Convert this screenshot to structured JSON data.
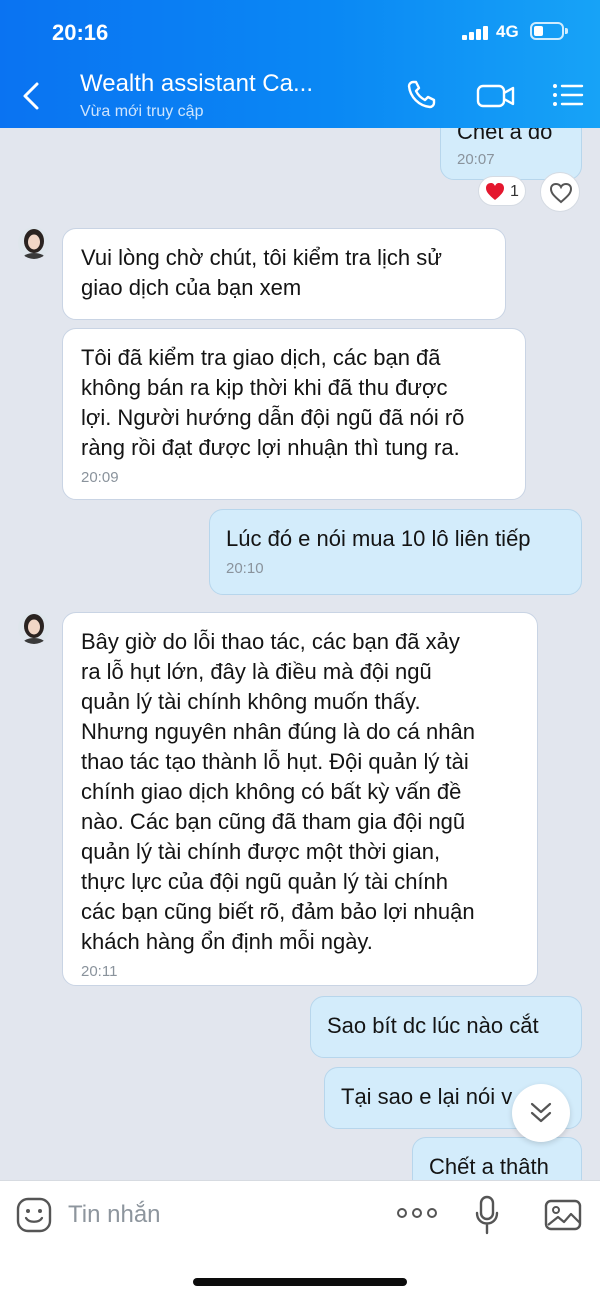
{
  "status_bar": {
    "time": "20:16",
    "network": "4G"
  },
  "header": {
    "title": "Wealth assistant Ca...",
    "subtitle": "Vừa mới truy cập"
  },
  "messages": [
    {
      "direction": "out",
      "text": "Chết a đó",
      "time": "20:07",
      "reaction": {
        "emoji": "heart",
        "count": "1"
      }
    },
    {
      "direction": "in",
      "text": "Vui lòng chờ chút, tôi kiểm tra lịch sử\ngiao dịch của bạn xem",
      "time": ""
    },
    {
      "direction": "in",
      "text": "Tôi đã kiểm tra giao dịch, các bạn đã\nkhông bán ra kịp thời khi đã thu được\nlợi.  Người hướng dẫn đội ngũ đã nói rõ\nràng rồi đạt được lợi nhuận thì tung ra.",
      "time": "20:09"
    },
    {
      "direction": "out",
      "text": "Lúc đó e nói mua 10 lô liên tiếp",
      "time": "20:10"
    },
    {
      "direction": "in",
      "text": "Bây giờ do lỗi thao tác, các bạn đã xảy\nra lỗ hụt lớn, đây là điều mà đội ngũ\nquản lý tài chính không muốn thấy.\nNhưng nguyên nhân đúng là do cá nhân\nthao tác tạo thành lỗ hụt. Đội quản lý tài\nchính giao dịch không có bất kỳ vấn đề\nnào. Các bạn cũng đã tham gia đội ngũ\nquản lý tài chính được một thời gian,\nthực lực của đội ngũ quản lý tài chính\ncác bạn cũng biết rõ, đảm bảo lợi nhuận\nkhách hàng ổn định mỗi ngày.",
      "time": "20:11"
    },
    {
      "direction": "out",
      "text": "Sao bít dc lúc nào cắt",
      "time": ""
    },
    {
      "direction": "out",
      "text": "Tại sao e lại nói v",
      "time": ""
    },
    {
      "direction": "out",
      "text": "Chết a thâth",
      "time": ""
    }
  ],
  "input": {
    "placeholder": "Tin nhắn"
  },
  "colors": {
    "header_start": "#0a73f2",
    "header_end": "#17a3f7",
    "outgoing_bubble": "#d3ecfb",
    "incoming_bubble": "#ffffff",
    "background": "#e2e6ee"
  },
  "icons": [
    "back-icon",
    "phone-icon",
    "video-call-icon",
    "menu-icon",
    "heart-icon",
    "react-heart-outline-icon",
    "chevron-down-icon",
    "sticker-icon",
    "more-icon",
    "microphone-icon",
    "image-icon"
  ]
}
